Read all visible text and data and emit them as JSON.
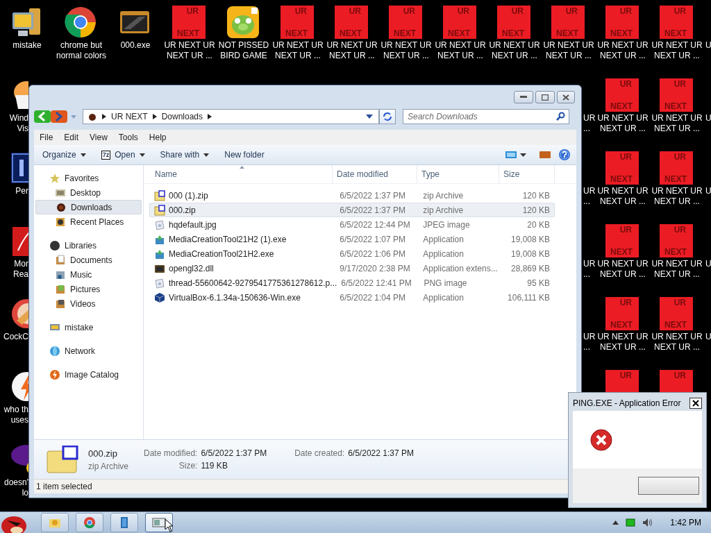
{
  "desktop": {
    "icons": [
      {
        "kind": "computer",
        "lines": [
          "mistake"
        ]
      },
      {
        "kind": "chrome",
        "lines": [
          "chrome but",
          "normal colors"
        ]
      },
      {
        "kind": "film",
        "lines": [
          "000.exe"
        ]
      },
      {
        "kind": "tile",
        "tile": [
          "UR",
          "NEXT"
        ],
        "lines": [
          "UR NEXT UR",
          "NEXT UR ..."
        ]
      },
      {
        "kind": "pig",
        "lines": [
          "NOT PISSED",
          "BIRD GAME"
        ]
      },
      {
        "kind": "tile",
        "tile": [
          "UR",
          "NEXT"
        ],
        "lines": [
          "UR NEXT UR",
          "NEXT UR ..."
        ]
      },
      {
        "kind": "tile",
        "tile": [
          "UR",
          "NEXT"
        ],
        "lines": [
          "UR NEXT UR",
          "NEXT UR ..."
        ]
      },
      {
        "kind": "tile",
        "tile": [
          "UR",
          "NEXT"
        ],
        "lines": [
          "UR NEXT UR",
          "NEXT UR ..."
        ]
      },
      {
        "kind": "tile",
        "tile": [
          "UR",
          "NEXT"
        ],
        "lines": [
          "UR NEXT UR",
          "NEXT UR ..."
        ]
      },
      {
        "kind": "tile",
        "tile": [
          "UR",
          "NEXT"
        ],
        "lines": [
          "UR NEXT UR",
          "NEXT UR ..."
        ]
      },
      {
        "kind": "tile",
        "tile": [
          "UR",
          "NEXT"
        ],
        "lines": [
          "UR NEXT UR",
          "NEXT UR ..."
        ]
      },
      {
        "kind": "tile",
        "tile": [
          "UR",
          "NEXT"
        ],
        "lines": [
          "UR NEXT UR",
          "NEXT UR ..."
        ]
      },
      {
        "kind": "tile",
        "tile": [
          "UR",
          "NEXT"
        ],
        "lines": [
          "UR NEXT UR",
          "NEXT UR ..."
        ]
      },
      {
        "kind": "label",
        "lines": [
          "U"
        ]
      },
      {
        "kind": "egg",
        "lines": [
          "Wind",
          "Vis"
        ]
      },
      {
        "kind": "label",
        "lines": [
          "UR",
          "..."
        ]
      },
      {
        "kind": "tile",
        "tile": [
          "UR",
          "NEXT"
        ],
        "lines": [
          "UR NEXT UR",
          "NEXT UR ..."
        ]
      },
      {
        "kind": "tile",
        "tile": [
          "UR",
          "NEXT"
        ],
        "lines": [
          "UR NEXT UR",
          "NEXT UR ..."
        ]
      },
      {
        "kind": "label",
        "lines": [
          "U"
        ]
      },
      {
        "kind": "letter-tile",
        "lines": [
          "Per"
        ]
      },
      {
        "kind": "label",
        "lines": [
          "UR",
          "..."
        ]
      },
      {
        "kind": "tile",
        "tile": [
          "UR",
          "NEXT"
        ],
        "lines": [
          "UR NEXT UR",
          "NEXT UR ..."
        ]
      },
      {
        "kind": "tile",
        "tile": [
          "UR",
          "NEXT"
        ],
        "lines": [
          "UR NEXT UR",
          "NEXT UR ..."
        ]
      },
      {
        "kind": "label",
        "lines": [
          "U"
        ]
      },
      {
        "kind": "document",
        "lines": [
          "Mor",
          "Rea"
        ]
      },
      {
        "kind": "label",
        "lines": [
          "UR",
          "..."
        ]
      },
      {
        "kind": "tile",
        "tile": [
          "UR",
          "NEXT"
        ],
        "lines": [
          "UR NEXT UR",
          "NEXT UR ..."
        ]
      },
      {
        "kind": "tile",
        "tile": [
          "UR",
          "NEXT"
        ],
        "lines": [
          "UR NEXT UR",
          "NEXT UR ..."
        ]
      },
      {
        "kind": "label",
        "lines": [
          "U"
        ]
      },
      {
        "kind": "brush",
        "lines": [
          "CockC"
        ]
      },
      {
        "kind": "label",
        "lines": [
          "UR",
          "..."
        ]
      },
      {
        "kind": "tile",
        "tile": [
          "UR",
          "NEXT"
        ],
        "lines": [
          "UR NEXT UR",
          "NEXT UR ..."
        ]
      },
      {
        "kind": "tile",
        "tile": [
          "UR",
          "NEXT"
        ],
        "lines": [
          "UR NEXT UR",
          "NEXT UR ..."
        ]
      },
      {
        "kind": "label",
        "lines": [
          "U"
        ]
      },
      {
        "kind": "bolt",
        "lines": [
          "who th",
          "uses"
        ]
      },
      {
        "kind": "tile",
        "tile": [
          "UR"
        ]
      },
      {
        "kind": "tile",
        "tile": [
          "UR"
        ]
      },
      {
        "kind": "globe",
        "lines": [
          "doesn'",
          "lo"
        ]
      }
    ]
  },
  "explorer": {
    "address": [
      "UR NEXT",
      "Downloads"
    ],
    "search": {
      "placeholder": "Search Downloads"
    },
    "menu": [
      "File",
      "Edit",
      "View",
      "Tools",
      "Help"
    ],
    "commands": [
      {
        "label": "Organize",
        "menu": true
      },
      {
        "label": "Open",
        "menu": true,
        "badge": "7z"
      },
      {
        "label": "Share with",
        "menu": true
      },
      {
        "label": "New folder",
        "menu": false
      }
    ],
    "nav": [
      {
        "label": "Favorites",
        "kind": "star",
        "selected": false,
        "children": [
          {
            "label": "Desktop",
            "kind": "desktop",
            "selected": false
          },
          {
            "label": "Downloads",
            "kind": "downloads",
            "selected": true
          },
          {
            "label": "Recent Places",
            "kind": "recent",
            "selected": false
          }
        ]
      },
      {
        "label": "Libraries",
        "kind": "library",
        "selected": false,
        "children": [
          {
            "label": "Documents",
            "kind": "documents",
            "selected": false
          },
          {
            "label": "Music",
            "kind": "music",
            "selected": false
          },
          {
            "label": "Pictures",
            "kind": "pictures",
            "selected": false
          },
          {
            "label": "Videos",
            "kind": "videos",
            "selected": false
          }
        ]
      },
      {
        "label": "mistake",
        "kind": "computer",
        "selected": false
      },
      {
        "label": "Network",
        "kind": "network",
        "selected": false
      },
      {
        "label": "Image Catalog",
        "kind": "catalog",
        "selected": false
      }
    ],
    "columns": [
      "Name",
      "Date modified",
      "Type",
      "Size"
    ],
    "files": [
      {
        "name": "000 (1).zip",
        "date": "6/5/2022 1:37 PM",
        "type": "zip Archive",
        "size": "120 KB",
        "kind": "zip",
        "selected": false
      },
      {
        "name": "000.zip",
        "date": "6/5/2022 1:37 PM",
        "type": "zip Archive",
        "size": "120 KB",
        "kind": "zip",
        "selected": true
      },
      {
        "name": "hqdefault.jpg",
        "date": "6/5/2022 12:44 PM",
        "type": "JPEG image",
        "size": "20 KB",
        "kind": "image",
        "selected": false
      },
      {
        "name": "MediaCreationTool21H2 (1).exe",
        "date": "6/5/2022 1:07 PM",
        "type": "Application",
        "size": "19,008 KB",
        "kind": "setup",
        "selected": false
      },
      {
        "name": "MediaCreationTool21H2.exe",
        "date": "6/5/2022 1:06 PM",
        "type": "Application",
        "size": "19,008 KB",
        "kind": "setup",
        "selected": false
      },
      {
        "name": "opengl32.dll",
        "date": "9/17/2020 2:38 PM",
        "type": "Application extens...",
        "size": "28,869 KB",
        "kind": "dll",
        "selected": false
      },
      {
        "name": "thread-55600642-9279541775361278612.p...",
        "date": "6/5/2022 12:41 PM",
        "type": "PNG image",
        "size": "95 KB",
        "kind": "image",
        "selected": false
      },
      {
        "name": "VirtualBox-6.1.34a-150636-Win.exe",
        "date": "6/5/2022 1:04 PM",
        "type": "Application",
        "size": "106,111 KB",
        "kind": "cube",
        "selected": false
      }
    ],
    "details": {
      "name": "000.zip",
      "type": "zip Archive",
      "fields": [
        {
          "label": "Date modified:",
          "value": "6/5/2022 1:37 PM"
        },
        {
          "label": "Size:",
          "value": "119 KB"
        },
        {
          "label": "Date created:",
          "value": "6/5/2022 1:37 PM"
        }
      ]
    },
    "status": "1 item selected"
  },
  "dialog": {
    "title": "PING.EXE - Application Error"
  },
  "taskbar": {
    "buttons": [
      {
        "kind": "folder",
        "selected": false
      },
      {
        "kind": "chrome",
        "selected": false
      },
      {
        "kind": "book",
        "selected": false
      },
      {
        "kind": "explorer",
        "selected": true
      }
    ],
    "clock": "1:42 PM"
  }
}
